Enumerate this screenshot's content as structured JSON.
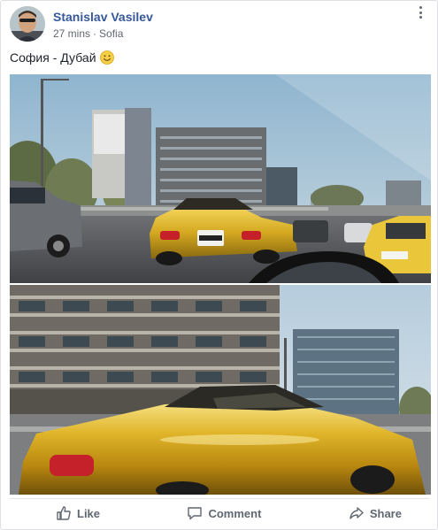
{
  "post": {
    "author": "Stanislav Vasilev",
    "time": "27 mins",
    "separator": "·",
    "location": "Sofia",
    "text": "София - Дубай",
    "emoji": "smiley-emoji",
    "more_icon": "more-options-icon"
  },
  "photos": [
    {
      "label": "photo-1",
      "plates": "CB 1234 KM"
    },
    {
      "label": "photo-2"
    }
  ],
  "actions": {
    "like": "Like",
    "comment": "Comment",
    "share": "Share",
    "like_icon": "thumbs-up-icon",
    "comment_icon": "comment-icon",
    "share_icon": "share-arrow-icon"
  },
  "colors": {
    "author": "#365899",
    "meta": "#616770",
    "action": "#606770",
    "gold_car": "#d4a820"
  }
}
